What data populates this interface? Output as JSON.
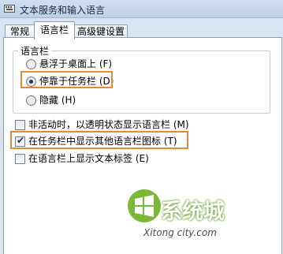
{
  "window": {
    "title": "文本服务和输入语言"
  },
  "tabs": [
    {
      "label": "常规",
      "active": false
    },
    {
      "label": "语言栏",
      "active": true
    },
    {
      "label": "高级键设置",
      "active": false
    }
  ],
  "language_bar_group": {
    "legend": "语言栏",
    "options": [
      {
        "label": "悬浮于桌面上 (F)",
        "selected": false
      },
      {
        "label": "停靠于任务栏 (D)",
        "selected": true
      },
      {
        "label": "隐藏 (H)",
        "selected": false
      }
    ]
  },
  "checkboxes": [
    {
      "label": "非活动时，以透明状态显示语言栏 (M)",
      "checked": false
    },
    {
      "label": "在任务栏中显示其他语言栏图标 (T)",
      "checked": true
    },
    {
      "label": "在语言栏上显示文本标签 (E)",
      "checked": false
    }
  ],
  "watermark": {
    "brand": "系统城",
    "url": "Xitong city.com"
  },
  "colors": {
    "highlight": "#e48b34",
    "accent": "#6aa02a"
  }
}
